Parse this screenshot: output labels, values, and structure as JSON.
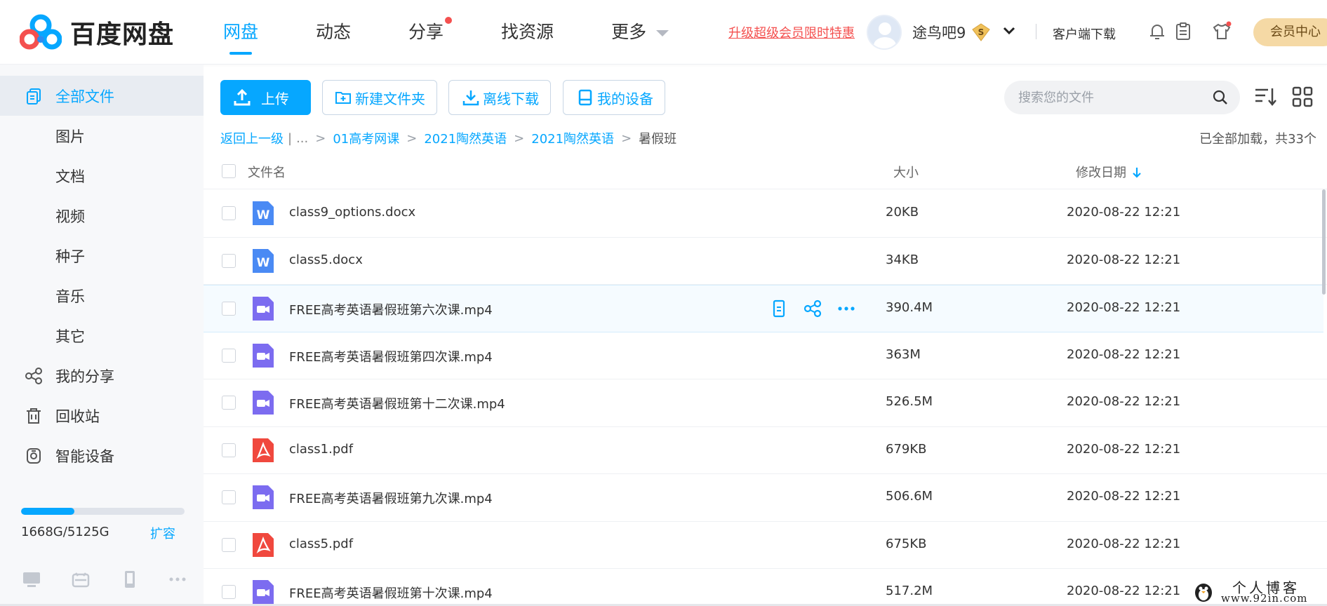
{
  "header": {
    "logo_text": "百度网盘",
    "nav": [
      {
        "label": "网盘",
        "active": true
      },
      {
        "label": "动态",
        "active": false
      },
      {
        "label": "分享",
        "active": false
      },
      {
        "label": "找资源",
        "active": false
      },
      {
        "label": "更多",
        "active": false
      }
    ],
    "promo": "升级超级会员限时特惠",
    "username": "途鸟吧9",
    "vip_badge": "S",
    "client_download": "客户端下载",
    "member_center": "会员中心"
  },
  "sidebar": {
    "items": [
      {
        "label": "全部文件",
        "icon": "files-icon",
        "active": true
      },
      {
        "label": "图片"
      },
      {
        "label": "文档"
      },
      {
        "label": "视频"
      },
      {
        "label": "种子"
      },
      {
        "label": "音乐"
      },
      {
        "label": "其它"
      },
      {
        "label": "我的分享",
        "icon": "share-icon"
      },
      {
        "label": "回收站",
        "icon": "trash-icon"
      },
      {
        "label": "智能设备",
        "icon": "smart-device-icon"
      }
    ],
    "quota": {
      "used_fraction": 0.326,
      "text": "1668G/5125G",
      "expand": "扩容"
    }
  },
  "toolbar": {
    "upload": "上传",
    "new_folder": "新建文件夹",
    "offline_download": "离线下载",
    "my_devices": "我的设备",
    "search_placeholder": "搜索您的文件"
  },
  "breadcrumb": {
    "back": "返回上一级",
    "ellipsis": "...",
    "path": [
      "01高考网课",
      "2021陶然英语",
      "2021陶然英语"
    ],
    "current": "暑假班",
    "status": "已全部加载，共33个"
  },
  "table": {
    "columns": {
      "name": "文件名",
      "size": "大小",
      "date": "修改日期"
    },
    "rows": [
      {
        "name": "class9_options.docx",
        "type": "word",
        "size": "20KB",
        "date": "2020-08-22 12:21"
      },
      {
        "name": "class5.docx",
        "type": "word",
        "size": "34KB",
        "date": "2020-08-22 12:21"
      },
      {
        "name": "FREE高考英语暑假班第六次课.mp4",
        "type": "video",
        "size": "390.4M",
        "date": "2020-08-22 12:21"
      },
      {
        "name": "FREE高考英语暑假班第四次课.mp4",
        "type": "video",
        "size": "363M",
        "date": "2020-08-22 12:21"
      },
      {
        "name": "FREE高考英语暑假班第十二次课.mp4",
        "type": "video",
        "size": "526.5M",
        "date": "2020-08-22 12:21"
      },
      {
        "name": "class1.pdf",
        "type": "pdf",
        "size": "679KB",
        "date": "2020-08-22 12:21"
      },
      {
        "name": "FREE高考英语暑假班第九次课.mp4",
        "type": "video",
        "size": "506.6M",
        "date": "2020-08-22 12:21"
      },
      {
        "name": "class5.pdf",
        "type": "pdf",
        "size": "675KB",
        "date": "2020-08-22 12:21"
      },
      {
        "name": "FREE高考英语暑假班第十次课.mp4",
        "type": "video",
        "size": "517.2M",
        "date": "2020-08-22 12:21"
      }
    ]
  },
  "watermark": {
    "line1": "个人博客",
    "line2": "www.92in.com"
  },
  "colors": {
    "accent": "#06a7ff",
    "red": "#f4504f",
    "word": "#4a8af4",
    "video": "#7c6cf0",
    "pdf": "#f0483e"
  }
}
